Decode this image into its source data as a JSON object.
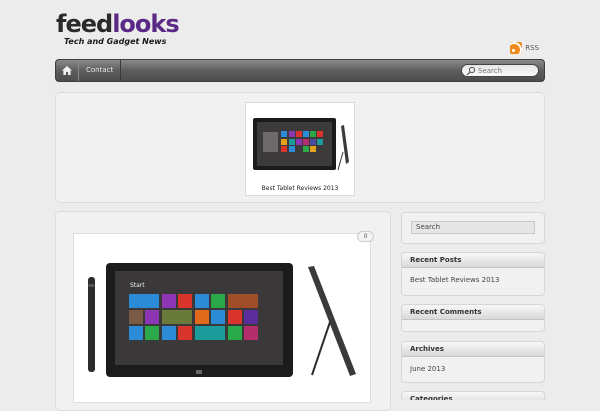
{
  "header": {
    "logo_part1": "feed",
    "logo_part2": "looks",
    "tagline": "Tech and Gadget News",
    "rss_label": "RSS"
  },
  "nav": {
    "contact_label": "Contact",
    "search_placeholder": "Search"
  },
  "featured": {
    "title": "Best Tablet Reviews 2013"
  },
  "post": {
    "comment_count": "0",
    "screen_start_label": "Start"
  },
  "sidebar": {
    "search_placeholder": "Search",
    "recent_posts_title": "Recent Posts",
    "recent_posts": [
      "Best Tablet Reviews 2013"
    ],
    "recent_comments_title": "Recent Comments",
    "archives_title": "Archives",
    "archives": [
      "June 2013"
    ],
    "categories_title": "Categories"
  },
  "colors": {
    "brand_purple": "#5b2a86",
    "rss_orange": "#f08a1c",
    "nav_dark": "#5e5e5e"
  }
}
